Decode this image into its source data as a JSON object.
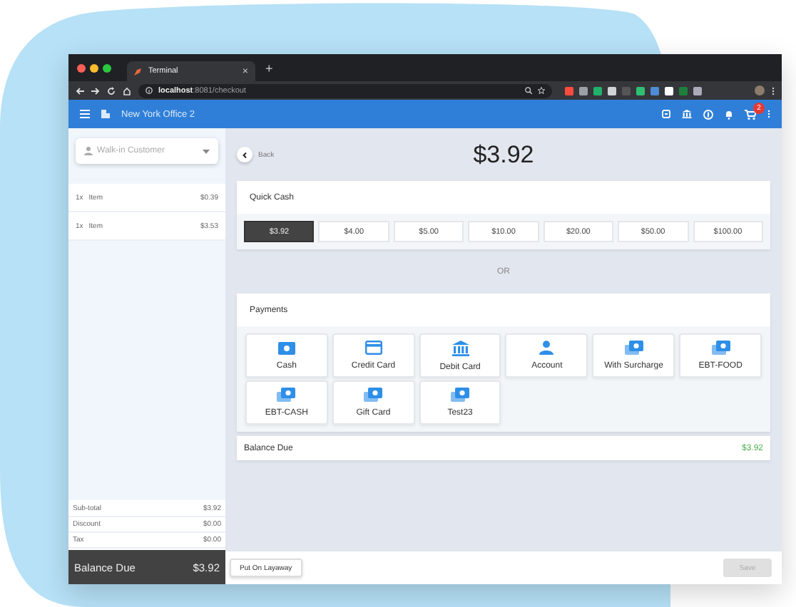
{
  "browser": {
    "tab_title": "Terminal",
    "tab_close": "×",
    "new_tab": "+",
    "url_host": "localhost",
    "url_path": ":8081/checkout"
  },
  "app_bar": {
    "location": "New York Office 2",
    "cart_badge": "2"
  },
  "customer": {
    "placeholder": "Walk-in Customer"
  },
  "items": [
    {
      "qty": "1x",
      "name": "Item",
      "price": "$0.39"
    },
    {
      "qty": "1x",
      "name": "Item",
      "price": "$3.53"
    }
  ],
  "totals": [
    {
      "label": "Sub-total",
      "value": "$3.92"
    },
    {
      "label": "Discount",
      "value": "$0.00"
    },
    {
      "label": "Tax",
      "value": "$0.00"
    }
  ],
  "sidebar_balance": {
    "label": "Balance Due",
    "value": "$3.92"
  },
  "back_label": "Back",
  "amount": "$3.92",
  "quick_cash": {
    "title": "Quick Cash",
    "options": [
      {
        "label": "$3.92",
        "selected": true
      },
      {
        "label": "$4.00",
        "selected": false
      },
      {
        "label": "$5.00",
        "selected": false
      },
      {
        "label": "$10.00",
        "selected": false
      },
      {
        "label": "$20.00",
        "selected": false
      },
      {
        "label": "$50.00",
        "selected": false
      },
      {
        "label": "$100.00",
        "selected": false
      }
    ]
  },
  "or_label": "OR",
  "payments": {
    "title": "Payments",
    "methods": [
      {
        "label": "Cash",
        "kind": "cash"
      },
      {
        "label": "Credit Card",
        "kind": "card"
      },
      {
        "label": "Debit Card",
        "kind": "bank"
      },
      {
        "label": "Account",
        "kind": "person"
      },
      {
        "label": "With Surcharge",
        "kind": "stack"
      },
      {
        "label": "EBT-FOOD",
        "kind": "stack"
      },
      {
        "label": "EBT-CASH",
        "kind": "stack"
      },
      {
        "label": "Gift Card",
        "kind": "stack"
      },
      {
        "label": "Test23",
        "kind": "stack"
      }
    ]
  },
  "balance_due": {
    "label": "Balance Due",
    "value": "$3.92"
  },
  "actions": {
    "layaway": "Put On Layaway",
    "save": {
      "label": "Save",
      "disabled": true
    }
  }
}
